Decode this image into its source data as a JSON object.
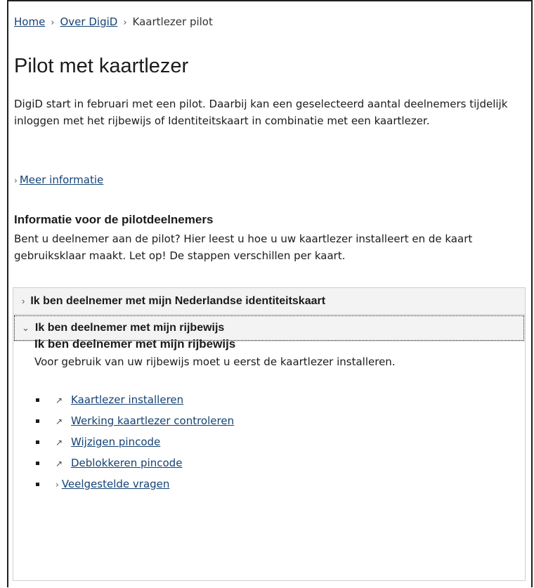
{
  "breadcrumb": {
    "items": [
      "Home",
      "Over DigiD",
      "Kaartlezer pilot"
    ],
    "separator": "›"
  },
  "page": {
    "title": "Pilot met kaartlezer",
    "intro": "DigiD start in februari met een pilot. Daarbij kan een geselecteerd aantal deelnemers tijdelijk inloggen met het rijbewijs of Identiteitskaart in combinatie met een kaartlezer.",
    "more_link": "Meer informatie"
  },
  "info": {
    "title": "Informatie voor de pilotdeelnemers",
    "text": "Bent u deelnemer aan de pilot? Hier leest u hoe u uw kaartlezer installeert en de kaart gebruiksklaar maakt. Let op! De stappen verschillen per kaart."
  },
  "accordion": {
    "items": [
      {
        "label": "Ik ben deelnemer met mijn Nederlandse identiteitskaart",
        "expanded": false
      },
      {
        "label": "Ik ben deelnemer met mijn rijbewijs",
        "expanded": true
      }
    ],
    "panel": {
      "title": "Ik ben deelnemer met mijn rijbewijs",
      "text": "Voor gebruik van uw rijbewijs moet u eerst de kaartlezer installeren.",
      "links": [
        {
          "label": "Kaartlezer installeren",
          "icon": "external-link-icon"
        },
        {
          "label": "Werking kaartlezer controleren",
          "icon": "external-link-icon"
        },
        {
          "label": "Wijzigen pincode",
          "icon": "external-link-icon"
        },
        {
          "label": "Deblokkeren pincode",
          "icon": "external-link-icon"
        },
        {
          "label": "Veelgestelde vragen",
          "icon": "chevron-right-icon"
        }
      ]
    }
  },
  "colors": {
    "link": "#154273",
    "header_bg": "#f3f3f3",
    "text": "#1b1b1b"
  }
}
